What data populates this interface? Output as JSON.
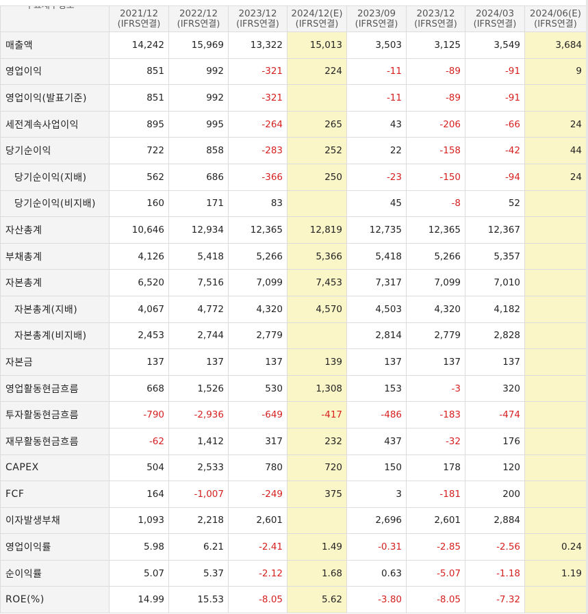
{
  "table": {
    "corner_label": "주요재무정보",
    "columns": [
      {
        "period": "2021/12",
        "basis": "(IFRS연결)",
        "est": false
      },
      {
        "period": "2022/12",
        "basis": "(IFRS연결)",
        "est": false
      },
      {
        "period": "2023/12",
        "basis": "(IFRS연결)",
        "est": false
      },
      {
        "period": "2024/12(E)",
        "basis": "(IFRS연결)",
        "est": true
      },
      {
        "period": "2023/09",
        "basis": "(IFRS연결)",
        "est": false
      },
      {
        "period": "2023/12",
        "basis": "(IFRS연결)",
        "est": false
      },
      {
        "period": "2024/03",
        "basis": "(IFRS연결)",
        "est": false
      },
      {
        "period": "2024/06(E)",
        "basis": "(IFRS연결)",
        "est": true
      }
    ],
    "rows": [
      {
        "label": "매출액",
        "indent": false,
        "values": [
          "14,242",
          "15,969",
          "13,322",
          "15,013",
          "3,503",
          "3,125",
          "3,549",
          "3,684"
        ]
      },
      {
        "label": "영업이익",
        "indent": false,
        "values": [
          "851",
          "992",
          "-321",
          "224",
          "-11",
          "-89",
          "-91",
          "9"
        ]
      },
      {
        "label": "영업이익(발표기준)",
        "indent": false,
        "values": [
          "851",
          "992",
          "-321",
          "",
          "-11",
          "-89",
          "-91",
          ""
        ]
      },
      {
        "label": "세전계속사업이익",
        "indent": false,
        "values": [
          "895",
          "995",
          "-264",
          "265",
          "43",
          "-206",
          "-66",
          "24"
        ]
      },
      {
        "label": "당기순이익",
        "indent": false,
        "values": [
          "722",
          "858",
          "-283",
          "252",
          "22",
          "-158",
          "-42",
          "44"
        ]
      },
      {
        "label": "당기순이익(지배)",
        "indent": true,
        "values": [
          "562",
          "686",
          "-366",
          "250",
          "-23",
          "-150",
          "-94",
          "24"
        ]
      },
      {
        "label": "당기순이익(비지배)",
        "indent": true,
        "values": [
          "160",
          "171",
          "83",
          "",
          "45",
          "-8",
          "52",
          ""
        ]
      },
      {
        "label": "자산총계",
        "indent": false,
        "values": [
          "10,646",
          "12,934",
          "12,365",
          "12,819",
          "12,735",
          "12,365",
          "12,367",
          ""
        ]
      },
      {
        "label": "부채총계",
        "indent": false,
        "values": [
          "4,126",
          "5,418",
          "5,266",
          "5,366",
          "5,418",
          "5,266",
          "5,357",
          ""
        ]
      },
      {
        "label": "자본총계",
        "indent": false,
        "values": [
          "6,520",
          "7,516",
          "7,099",
          "7,453",
          "7,317",
          "7,099",
          "7,010",
          ""
        ]
      },
      {
        "label": "자본총계(지배)",
        "indent": true,
        "values": [
          "4,067",
          "4,772",
          "4,320",
          "4,570",
          "4,503",
          "4,320",
          "4,182",
          ""
        ]
      },
      {
        "label": "자본총계(비지배)",
        "indent": true,
        "values": [
          "2,453",
          "2,744",
          "2,779",
          "",
          "2,814",
          "2,779",
          "2,828",
          ""
        ]
      },
      {
        "label": "자본금",
        "indent": false,
        "values": [
          "137",
          "137",
          "137",
          "139",
          "137",
          "137",
          "137",
          ""
        ]
      },
      {
        "label": "영업활동현금흐름",
        "indent": false,
        "values": [
          "668",
          "1,526",
          "530",
          "1,308",
          "153",
          "-3",
          "320",
          ""
        ]
      },
      {
        "label": "투자활동현금흐름",
        "indent": false,
        "values": [
          "-790",
          "-2,936",
          "-649",
          "-417",
          "-486",
          "-183",
          "-474",
          ""
        ]
      },
      {
        "label": "재무활동현금흐름",
        "indent": false,
        "values": [
          "-62",
          "1,412",
          "317",
          "232",
          "437",
          "-32",
          "176",
          ""
        ]
      },
      {
        "label": "CAPEX",
        "indent": false,
        "values": [
          "504",
          "2,533",
          "780",
          "720",
          "150",
          "178",
          "120",
          ""
        ]
      },
      {
        "label": "FCF",
        "indent": false,
        "values": [
          "164",
          "-1,007",
          "-249",
          "375",
          "3",
          "-181",
          "200",
          ""
        ]
      },
      {
        "label": "이자발생부채",
        "indent": false,
        "values": [
          "1,093",
          "2,218",
          "2,601",
          "",
          "2,696",
          "2,601",
          "2,884",
          ""
        ]
      },
      {
        "label": "영업이익률",
        "indent": false,
        "values": [
          "5.98",
          "6.21",
          "-2.41",
          "1.49",
          "-0.31",
          "-2.85",
          "-2.56",
          "0.24"
        ]
      },
      {
        "label": "순이익률",
        "indent": false,
        "values": [
          "5.07",
          "5.37",
          "-2.12",
          "1.68",
          "0.63",
          "-5.07",
          "-1.18",
          "1.19"
        ]
      },
      {
        "label": "ROE(%)",
        "indent": false,
        "values": [
          "14.99",
          "15.53",
          "-8.05",
          "5.62",
          "-3.80",
          "-8.05",
          "-7.32",
          ""
        ]
      }
    ]
  },
  "colors": {
    "negative": "#d61f1f",
    "estimate_bg": "#fbf6c8",
    "header_bg": "#f4f4f4",
    "grid": "#dcdcdc"
  }
}
